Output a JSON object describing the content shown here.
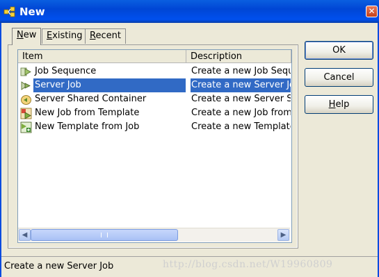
{
  "window": {
    "title": "New",
    "close_glyph": "✕"
  },
  "tabs": [
    {
      "acc": "N",
      "rest": "ew",
      "active": true
    },
    {
      "acc": "E",
      "rest": "xisting",
      "active": false
    },
    {
      "acc": "R",
      "rest": "ecent",
      "active": false
    }
  ],
  "list": {
    "columns": [
      "Item",
      "Description"
    ],
    "rows": [
      {
        "item": "Job Sequence",
        "description": "Create a new Job Seque",
        "icon": "job-sequence-icon",
        "selected": false
      },
      {
        "item": "Server Job",
        "description": "Create a new Server Job",
        "icon": "server-job-icon",
        "selected": true
      },
      {
        "item": "Server Shared Container",
        "description": "Create a new Server Sha",
        "icon": "shared-container-icon",
        "selected": false
      },
      {
        "item": "New Job from Template",
        "description": "Create a new Job from ar",
        "icon": "job-template-icon",
        "selected": false
      },
      {
        "item": "New Template from Job",
        "description": "Create a new Template f",
        "icon": "template-from-job-icon",
        "selected": false
      }
    ],
    "scroll_left_glyph": "◀",
    "scroll_right_glyph": "▶"
  },
  "buttons": {
    "ok": "OK",
    "cancel": "Cancel",
    "help_acc": "H",
    "help_rest": "elp"
  },
  "status": {
    "text": "Create a new Server Job",
    "watermark": "http://blog.csdn.net/W19960809"
  },
  "colors": {
    "titlebar": "#0046d5",
    "selection": "#316ac5",
    "dialog_bg": "#ece9d8"
  }
}
